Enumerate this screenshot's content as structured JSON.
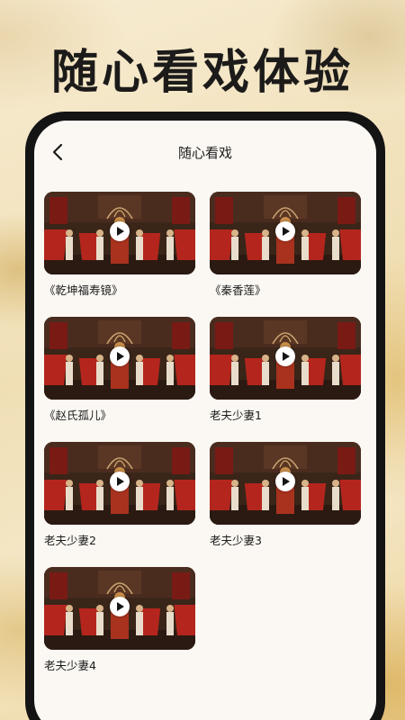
{
  "headline": "随心看戏体验",
  "nav": {
    "back_icon": "chevron-left-icon",
    "title": "随心看戏"
  },
  "videos": [
    {
      "title": "《乾坤福寿镜》"
    },
    {
      "title": "《秦香莲》"
    },
    {
      "title": "《赵氏孤儿》"
    },
    {
      "title": "老夫少妻1"
    },
    {
      "title": "老夫少妻2"
    },
    {
      "title": "老夫少妻3"
    },
    {
      "title": "老夫少妻4"
    }
  ],
  "colors": {
    "headline": "#1c1b1a",
    "phone_frame": "#141414",
    "screen_bg": "#fbf8f3",
    "stage_red": "#b4261d",
    "stage_dark": "#2a1c15"
  },
  "icons": {
    "play": "play-icon"
  }
}
